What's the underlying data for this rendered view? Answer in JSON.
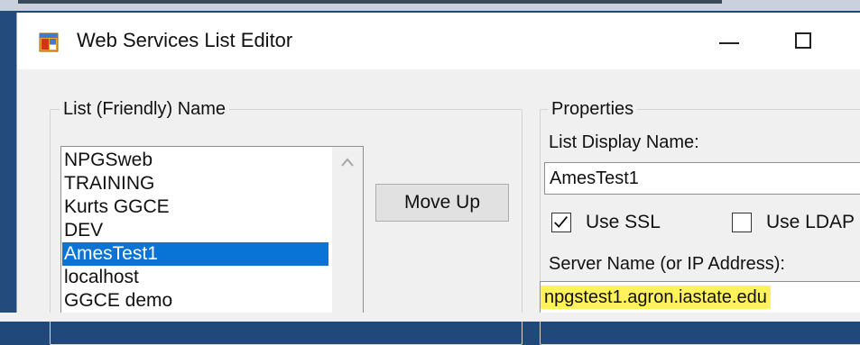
{
  "window": {
    "title": "Web Services List Editor",
    "icon": "app-window-icon"
  },
  "title_buttons": {
    "minimize_icon": "minimize-icon",
    "maximize_icon": "maximize-icon"
  },
  "list_group": {
    "legend": "List (Friendly) Name",
    "items": [
      {
        "label": "NPGSweb"
      },
      {
        "label": "TRAINING"
      },
      {
        "label": "Kurts GGCE"
      },
      {
        "label": "DEV"
      },
      {
        "label": "AmesTest1"
      },
      {
        "label": "localhost"
      },
      {
        "label": "GGCE demo"
      }
    ],
    "selected_value": "AmesTest1"
  },
  "actions": {
    "move_up_label": "Move Up"
  },
  "properties": {
    "legend": "Properties",
    "list_display_name_label": "List Display Name:",
    "list_display_name_value": "AmesTest1",
    "use_ssl_label": "Use SSL",
    "use_ssl_checked": true,
    "use_ldap_label": "Use LDAP",
    "use_ldap_checked": false,
    "server_name_label": "Server Name (or IP Address):",
    "server_name_value": "npgstest1.agron.iastate.edu",
    "highlight_color": "#fff25a"
  },
  "colors": {
    "selection": "#0a74d6",
    "window_bg": "#f0f0f0",
    "desktop": "#20497a"
  }
}
